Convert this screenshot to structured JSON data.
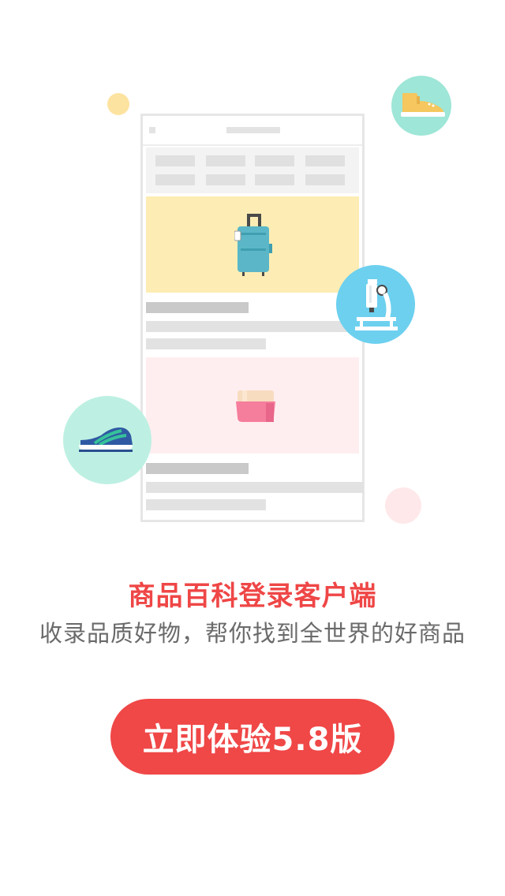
{
  "promo": {
    "headline": "商品百科登录客户端",
    "subline": "收录品质好物，帮你找到全世界的好商品",
    "cta_label": "立即体验5.8版"
  },
  "icons": {
    "sneaker_top": "sneaker-icon",
    "suitcase": "suitcase-icon",
    "microscope": "microscope-icon",
    "cream_jar": "cream-jar-icon",
    "running_shoe": "running-shoe-icon"
  },
  "colors": {
    "accent": "#f04747",
    "headline": "#ef4646",
    "subline": "#6a6a6a"
  }
}
